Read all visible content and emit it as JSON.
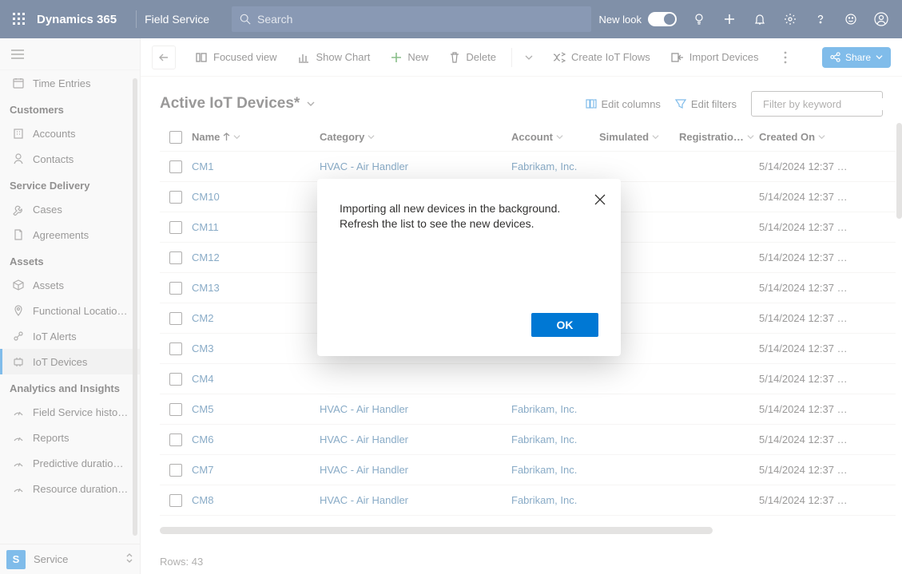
{
  "top": {
    "brand": "Dynamics 365",
    "module": "Field Service",
    "search_placeholder": "Search",
    "new_look_label": "New look"
  },
  "sidebar": {
    "time_entries": "Time Entries",
    "sections": {
      "customers": "Customers",
      "service_delivery": "Service Delivery",
      "assets": "Assets",
      "analytics": "Analytics and Insights"
    },
    "items": {
      "accounts": "Accounts",
      "contacts": "Contacts",
      "cases": "Cases",
      "agreements": "Agreements",
      "assets": "Assets",
      "functional_locations": "Functional Locatio…",
      "iot_alerts": "IoT Alerts",
      "iot_devices": "IoT Devices",
      "fs_history": "Field Service histo…",
      "reports": "Reports",
      "predictive": "Predictive duratio…",
      "resource": "Resource duration…"
    },
    "footer": {
      "initial": "S",
      "label": "Service"
    }
  },
  "commands": {
    "focused_view": "Focused view",
    "show_chart": "Show Chart",
    "new": "New",
    "delete": "Delete",
    "create_iot_flows": "Create IoT Flows",
    "import_devices": "Import Devices",
    "share": "Share"
  },
  "view": {
    "title": "Active IoT Devices*",
    "edit_columns": "Edit columns",
    "edit_filters": "Edit filters",
    "filter_placeholder": "Filter by keyword"
  },
  "columns": {
    "name": "Name",
    "category": "Category",
    "account": "Account",
    "simulated": "Simulated",
    "registration": "Registratio…",
    "created_on": "Created On"
  },
  "rows": [
    {
      "name": "CM1",
      "category": "HVAC - Air Handler",
      "account": "Fabrikam, Inc.",
      "created": "5/14/2024 12:37 …"
    },
    {
      "name": "CM10",
      "category": "",
      "account": "",
      "created": "5/14/2024 12:37 …"
    },
    {
      "name": "CM11",
      "category": "",
      "account": "",
      "created": "5/14/2024 12:37 …"
    },
    {
      "name": "CM12",
      "category": "",
      "account": "",
      "created": "5/14/2024 12:37 …"
    },
    {
      "name": "CM13",
      "category": "",
      "account": "",
      "created": "5/14/2024 12:37 …"
    },
    {
      "name": "CM2",
      "category": "",
      "account": "",
      "created": "5/14/2024 12:37 …"
    },
    {
      "name": "CM3",
      "category": "",
      "account": "",
      "created": "5/14/2024 12:37 …"
    },
    {
      "name": "CM4",
      "category": "",
      "account": "",
      "created": "5/14/2024 12:37 …"
    },
    {
      "name": "CM5",
      "category": "HVAC - Air Handler",
      "account": "Fabrikam, Inc.",
      "created": "5/14/2024 12:37 …"
    },
    {
      "name": "CM6",
      "category": "HVAC - Air Handler",
      "account": "Fabrikam, Inc.",
      "created": "5/14/2024 12:37 …"
    },
    {
      "name": "CM7",
      "category": "HVAC - Air Handler",
      "account": "Fabrikam, Inc.",
      "created": "5/14/2024 12:37 …"
    },
    {
      "name": "CM8",
      "category": "HVAC - Air Handler",
      "account": "Fabrikam, Inc.",
      "created": "5/14/2024 12:37 …"
    }
  ],
  "footer": {
    "rows_label": "Rows: 43"
  },
  "modal": {
    "message": "Importing all new devices in the background. Refresh the list to see the new devices.",
    "ok": "OK"
  }
}
